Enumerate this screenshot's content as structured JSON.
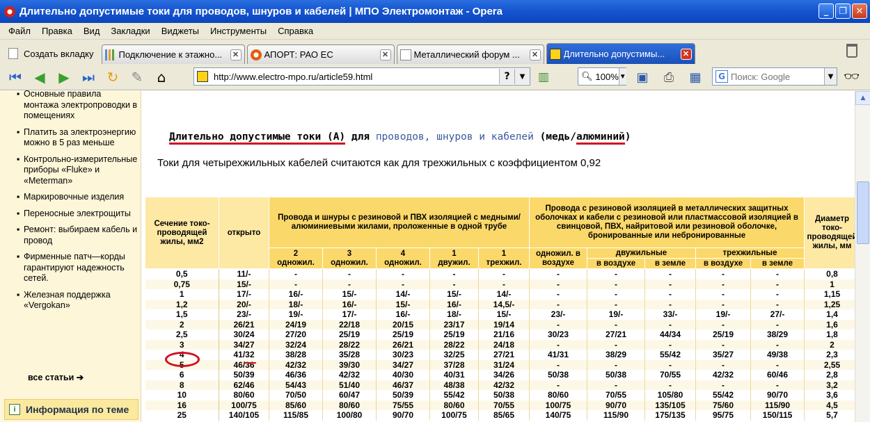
{
  "window": {
    "title": "Длительно допустимые токи для проводов, шнуров и кабелей | МПО Электромонтаж - Opera",
    "minimize": "_",
    "maximize": "❐",
    "close": "✕"
  },
  "menu": [
    "Файл",
    "Правка",
    "Вид",
    "Закладки",
    "Виджеты",
    "Инструменты",
    "Справка"
  ],
  "tabs": {
    "new_tab": "Создать вкладку",
    "items": [
      {
        "label": "Подключение к этажно...",
        "icon": "chart",
        "active": false
      },
      {
        "label": "АПОРТ: РАО ЕС",
        "icon": "aport",
        "active": false
      },
      {
        "label": "Металлический форум ...",
        "icon": "doc",
        "active": false
      },
      {
        "label": "Длительно допустимы...",
        "icon": "bolt",
        "active": true
      }
    ],
    "close_glyph": "✕"
  },
  "toolbar": {
    "url": "http://www.electro-mpo.ru/article59.html",
    "help": "?",
    "zoom": "100%",
    "search_placeholder": "Поиск: Google",
    "dropdown": "▼"
  },
  "sidebar": {
    "items": [
      "Основные правила монтажа электропроводки в помещениях",
      "Платить за электроэнергию можно в 5 раз меньше",
      "Контрольно-измерительные приборы «Fluke» и «Meterman»",
      "Маркировочные изделия",
      "Переносные электрощиты",
      "Ремонт: выбираем кабель и провод",
      "Фирменные патч—корды гарантируют надежность сетей.",
      "Железная поддержка «Vergokan»"
    ],
    "bullet": "▪",
    "all_articles": "все статьи ➔",
    "info": "Информация по теме",
    "info_icon": "i"
  },
  "content": {
    "heading": {
      "part1": "Длительно допустимые токи (А)",
      "part2": " для ",
      "link1": "проводов,",
      "link2": "шнуров",
      "sep": " и ",
      "link3": "кабелей",
      "part3": " (медь/",
      "part4": "алюминий",
      "part5": ")"
    },
    "subhead": "Токи для четырехжильных кабелей считаются как для трехжильных с коэффициентом 0,92",
    "table": {
      "h_section": "Сечение токо-проводящей жилы, мм2",
      "h_open": "открыто",
      "h_group1": "Провода и шнуры с резиновой и ПВХ изоляцией с медными/алюминиевыми жилами, проложенные в одной трубе",
      "h_group2": "Провода с резиновой изоляцией в металлических защитных оболочках и кабели с резиновой или пластмассовой изоляцией в свинцовой, ПВХ, найритовой или резиновой оболочке, бронированные или небронированные",
      "h_last": "Диаметр токо-проводящей жилы, мм",
      "g1_sub": [
        {
          "num": "2",
          "txt": "одножил."
        },
        {
          "num": "3",
          "txt": "одножил."
        },
        {
          "num": "4",
          "txt": "одножил."
        },
        {
          "num": "1",
          "txt": "двужил."
        },
        {
          "num": "1",
          "txt": "трехжил."
        }
      ],
      "g2_single": "одножил. в воздухе",
      "g2_two": "двужильные",
      "g2_three": "трехжильные",
      "in_air": "в воздухе",
      "in_ground": "в земле",
      "rows": [
        [
          "0,5",
          "11/-",
          "-",
          "-",
          "-",
          "-",
          "-",
          "-",
          "-",
          "-",
          "-",
          "-",
          "0,8"
        ],
        [
          "0,75",
          "15/-",
          "-",
          "-",
          "-",
          "-",
          "-",
          "-",
          "-",
          "-",
          "-",
          "-",
          "1"
        ],
        [
          "1",
          "17/-",
          "16/-",
          "15/-",
          "14/-",
          "15/-",
          "14/-",
          "-",
          "-",
          "-",
          "-",
          "-",
          "1,15"
        ],
        [
          "1,2",
          "20/-",
          "18/-",
          "16/-",
          "15/-",
          "16/-",
          "14,5/-",
          "-",
          "-",
          "-",
          "-",
          "-",
          "1,25"
        ],
        [
          "1,5",
          "23/-",
          "19/-",
          "17/-",
          "16/-",
          "18/-",
          "15/-",
          "23/-",
          "19/-",
          "33/-",
          "19/-",
          "27/-",
          "1,4"
        ],
        [
          "2",
          "26/21",
          "24/19",
          "22/18",
          "20/15",
          "23/17",
          "19/14",
          "-",
          "-",
          "-",
          "-",
          "-",
          "1,6"
        ],
        [
          "2,5",
          "30/24",
          "27/20",
          "25/19",
          "25/19",
          "25/19",
          "21/16",
          "30/23",
          "27/21",
          "44/34",
          "25/19",
          "38/29",
          "1,8"
        ],
        [
          "3",
          "34/27",
          "32/24",
          "28/22",
          "26/21",
          "28/22",
          "24/18",
          "-",
          "-",
          "-",
          "-",
          "-",
          "2"
        ],
        [
          "4",
          "41/32",
          "38/28",
          "35/28",
          "30/23",
          "32/25",
          "27/21",
          "41/31",
          "38/29",
          "55/42",
          "35/27",
          "49/38",
          "2,3"
        ],
        [
          "5",
          "46/36",
          "42/32",
          "39/30",
          "34/27",
          "37/28",
          "31/24",
          "-",
          "-",
          "-",
          "-",
          "-",
          "2,55"
        ],
        [
          "6",
          "50/39",
          "46/36",
          "42/32",
          "40/30",
          "40/31",
          "34/26",
          "50/38",
          "50/38",
          "70/55",
          "42/32",
          "60/46",
          "2,8"
        ],
        [
          "8",
          "62/46",
          "54/43",
          "51/40",
          "46/37",
          "48/38",
          "42/32",
          "-",
          "-",
          "-",
          "-",
          "-",
          "3,2"
        ],
        [
          "10",
          "80/60",
          "70/50",
          "60/47",
          "50/39",
          "55/42",
          "50/38",
          "80/60",
          "70/55",
          "105/80",
          "55/42",
          "90/70",
          "3,6"
        ],
        [
          "16",
          "100/75",
          "85/60",
          "80/60",
          "75/55",
          "80/60",
          "70/55",
          "100/75",
          "90/70",
          "135/105",
          "75/60",
          "115/90",
          "4,5"
        ],
        [
          "25",
          "140/105",
          "115/85",
          "100/80",
          "90/70",
          "100/75",
          "85/65",
          "140/75",
          "115/90",
          "175/135",
          "95/75",
          "150/115",
          "5,7"
        ]
      ]
    }
  }
}
